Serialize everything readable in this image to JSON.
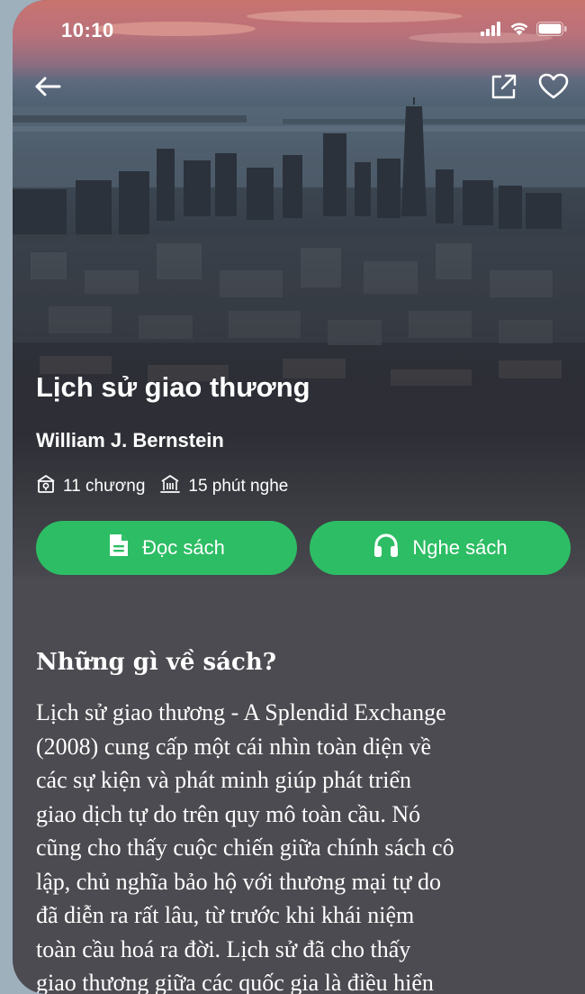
{
  "status_bar": {
    "time": "10:10",
    "icons": [
      "signal-icon",
      "wifi-icon",
      "battery-icon"
    ]
  },
  "nav": {
    "back_icon": "arrow-left-icon",
    "share_icon": "share-icon",
    "favorite_icon": "heart-icon"
  },
  "book": {
    "title": "Lịch sử giao thương",
    "author": "William J. Bernstein",
    "chapters": "11 chương",
    "duration": "15 phút nghe"
  },
  "actions": {
    "read_label": "Đọc sách",
    "listen_label": "Nghe sách",
    "read_icon": "document-icon",
    "listen_icon": "headphones-icon"
  },
  "about": {
    "heading": "Những gì về sách?",
    "lines": [
      "Lịch sử giao thương - A Splendid Exchange",
      "(2008) cung cấp một cái nhìn toàn diện về",
      "các sự kiện và phát minh giúp phát triển",
      "giao dịch tự do trên quy mô toàn cầu. Nó",
      "cũng cho thấy cuộc chiến giữa chính sách cô",
      "lập, chủ nghĩa bảo hộ với thương mại tự do",
      "đã diễn ra rất lâu, từ trước khi khái niệm",
      "toàn cầu hoá ra đời. Lịch sử đã cho thấy",
      "giao thương giữa các quốc gia là điều hiển"
    ]
  },
  "colors": {
    "accent": "#2dbd64",
    "background": "#4b4b51",
    "text": "#ffffff"
  }
}
